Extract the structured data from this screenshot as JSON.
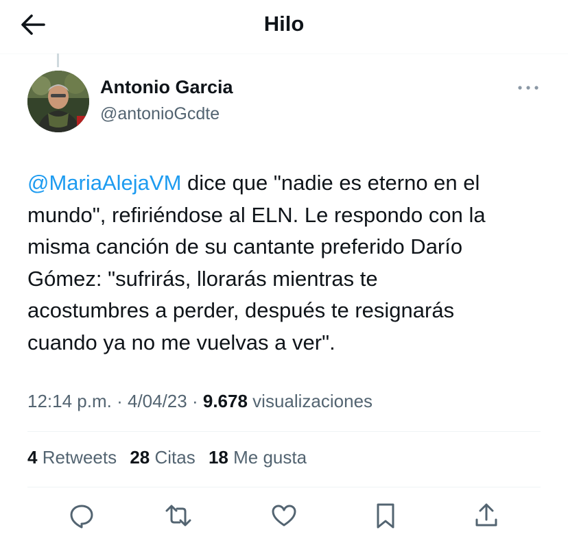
{
  "header": {
    "title": "Hilo"
  },
  "author": {
    "name": "Antonio Garcia",
    "handle": "@antonioGcdte"
  },
  "tweet": {
    "mention": "@MariaAlejaVM",
    "lines": [
      " dice que \"nadie es eterno en el",
      "mundo\", refiriéndose al ELN. Le respondo con la",
      "misma canción de su cantante preferido Darío",
      "Gómez: \"sufrirás, llorarás mientras te",
      "acostumbres a perder, después te resignarás",
      "cuando ya no me vuelvas a ver\"."
    ]
  },
  "meta": {
    "time": "12:14 p.m.",
    "date": "4/04/23",
    "views_count": "9.678",
    "views_label": "visualizaciones"
  },
  "stats": {
    "retweets_count": "4",
    "retweets_label": "Retweets",
    "quotes_count": "28",
    "quotes_label": "Citas",
    "likes_count": "18",
    "likes_label": "Me gusta"
  },
  "icons": {
    "back": "arrow-left-icon",
    "more": "more-horizontal-icon",
    "reply": "reply-icon",
    "retweet": "retweet-icon",
    "like": "heart-icon",
    "bookmark": "bookmark-icon",
    "share": "share-icon"
  },
  "colors": {
    "accent": "#1d9bf0",
    "text": "#0f1419",
    "secondary": "#536471"
  }
}
